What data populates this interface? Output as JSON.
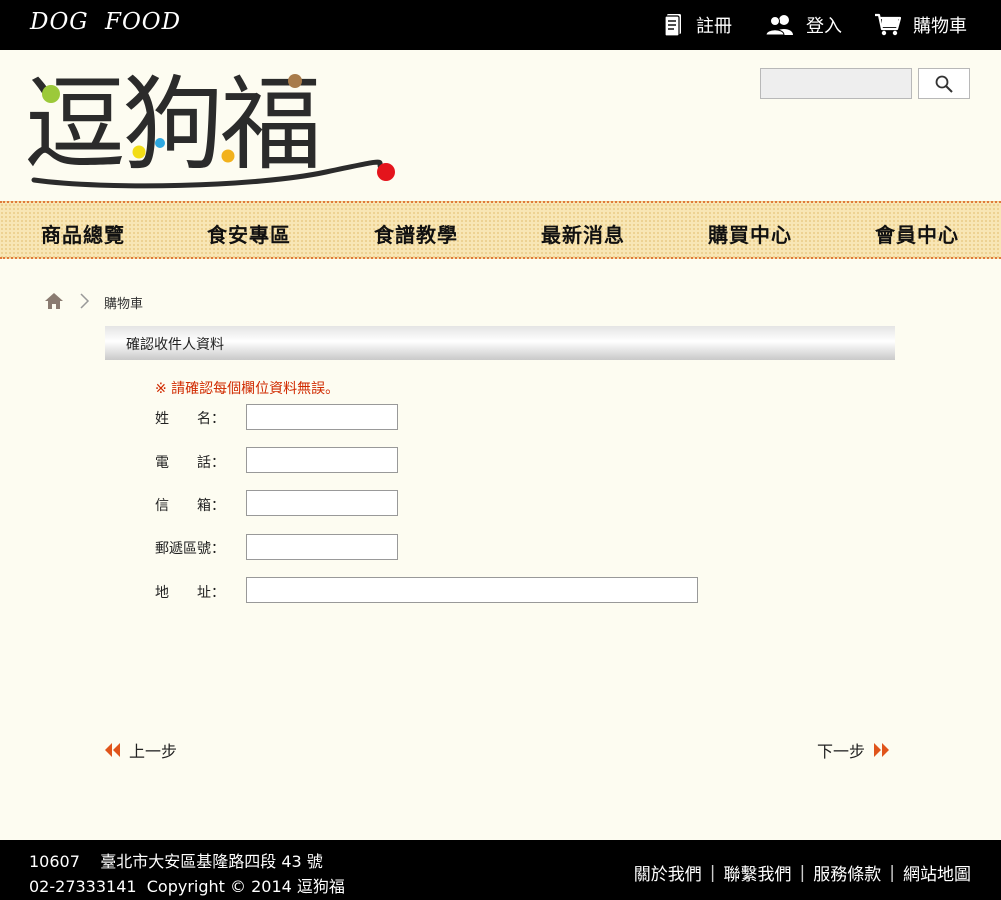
{
  "site": {
    "name": "DOG  FOOD",
    "logo_text": "逗狗福"
  },
  "topnav": {
    "register": "註冊",
    "login": "登入",
    "cart": "購物車"
  },
  "search": {
    "placeholder": ""
  },
  "mainnav": [
    "商品總覽",
    "食安專區",
    "食譜教學",
    "最新消息",
    "購買中心",
    "會員中心"
  ],
  "breadcrumb": {
    "current": "購物車"
  },
  "section": {
    "title": "確認收件人資料"
  },
  "notice": "※ 請確認每個欄位資料無誤。",
  "form": {
    "name_label": "姓　　名：",
    "phone_label": "電　　話：",
    "email_label": "信　　箱：",
    "zip_label": "郵遞區號：",
    "address_label": "地　　址：",
    "name_value": "",
    "phone_value": "",
    "email_value": "",
    "zip_value": "",
    "address_value": ""
  },
  "nav_buttons": {
    "prev": "上一步",
    "next": "下一步"
  },
  "footer": {
    "line1": "10607    臺北市大安區基隆路四段 43 號",
    "line2": "02-27333141  Copyright © 2014 逗狗福",
    "links": [
      "關於我們",
      "聯繫我們",
      "服務條款",
      "網站地圖"
    ]
  },
  "colors": {
    "accent": "#e0541b",
    "notice": "#d02a00",
    "nav_bg": "#f8e6b5"
  },
  "icons": [
    "register-icon",
    "login-icon",
    "cart-icon",
    "search-icon",
    "home-icon",
    "chevron-right-icon",
    "prev-arrow-icon",
    "next-arrow-icon"
  ]
}
